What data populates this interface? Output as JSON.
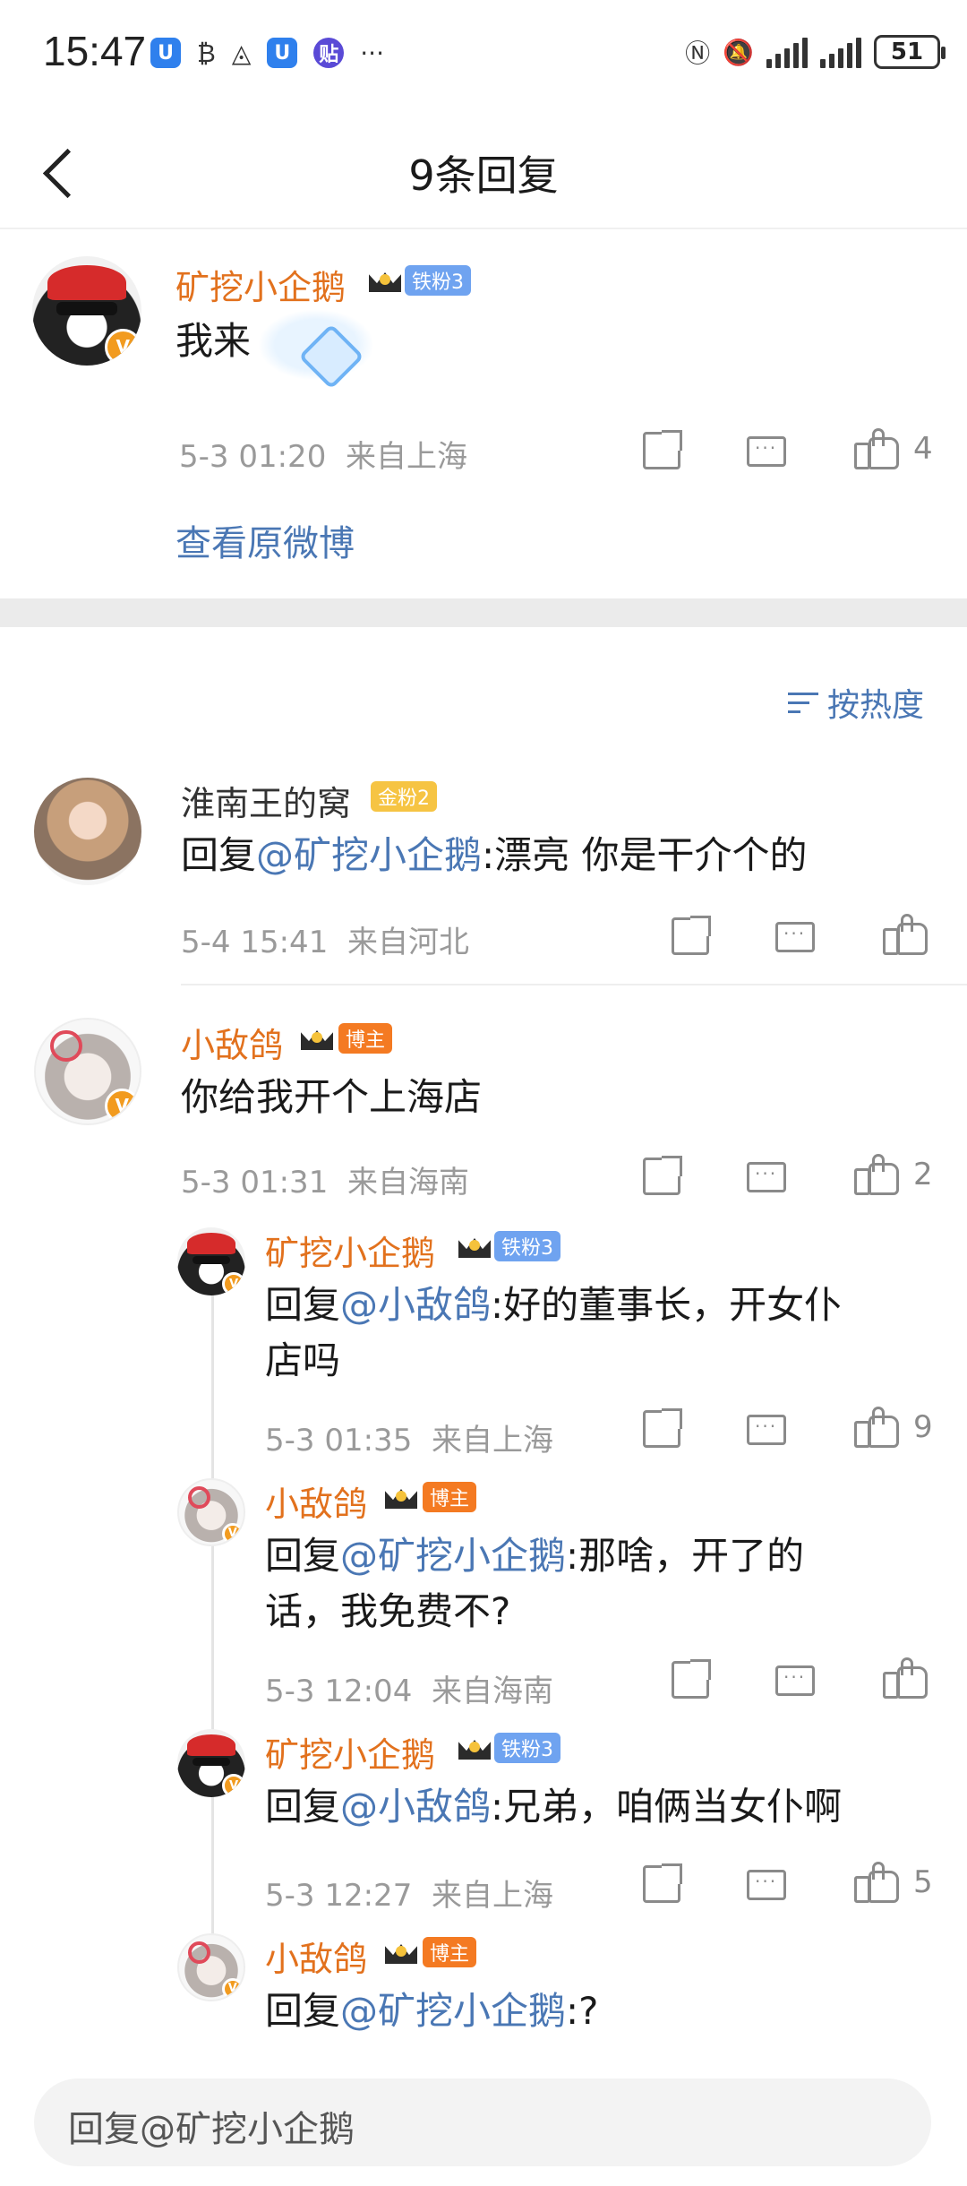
{
  "status_bar": {
    "time": "15:47",
    "app_icons": [
      "U",
      "₿",
      "◬",
      "U",
      "贴",
      "···"
    ],
    "battery": "51"
  },
  "header": {
    "title": "9条回复"
  },
  "root_comment": {
    "user": "矿挖小企鹅",
    "fan_tag": "铁粉3",
    "text": "我来",
    "time": "5-3 01:20",
    "location": "来自上海",
    "likes": "4",
    "view_original": "查看原微博"
  },
  "sort_label": "按热度",
  "replies": [
    {
      "user": "淮南王的窝",
      "tag": "金粉2",
      "prefix": "回复",
      "mention": "@矿挖小企鹅",
      "text": ":漂亮 你是干介个的",
      "time": "5-4 15:41",
      "location": "来自河北",
      "likes": ""
    },
    {
      "user": "小敌鸽",
      "tag": "博主",
      "text": "你给我开个上海店",
      "time": "5-3 01:31",
      "location": "来自海南",
      "likes": "2"
    }
  ],
  "sub_replies": [
    {
      "user": "矿挖小企鹅",
      "tag": "铁粉3",
      "prefix": "回复",
      "mention": "@小敌鸽",
      "text_line1": ":好的董事长，开女仆",
      "text_line2": "店吗",
      "time": "5-3 01:35",
      "location": "来自上海",
      "likes": "9"
    },
    {
      "user": "小敌鸽",
      "tag": "博主",
      "prefix": "回复",
      "mention": "@矿挖小企鹅",
      "text_line1": ":那啥，开了的",
      "text_line2": "话，我免费不?",
      "time": "5-3 12:04",
      "location": "来自海南",
      "likes": ""
    },
    {
      "user": "矿挖小企鹅",
      "tag": "铁粉3",
      "prefix": "回复",
      "mention": "@小敌鸽",
      "text_line1": ":兄弟，咱俩当女仆啊",
      "time": "5-3 12:27",
      "location": "来自上海",
      "likes": "5"
    },
    {
      "user": "小敌鸽",
      "tag": "博主",
      "prefix": "回复",
      "mention": "@矿挖小企鹅",
      "text_line1": ":?"
    }
  ],
  "reply_input": {
    "placeholder": "回复@矿挖小企鹅"
  },
  "colors": {
    "accent_name": "#e2711d",
    "link": "#4a77b4",
    "iron_fan": "#6fa3f0",
    "blogger": "#f47a22",
    "gold_fan": "#f6c443"
  }
}
